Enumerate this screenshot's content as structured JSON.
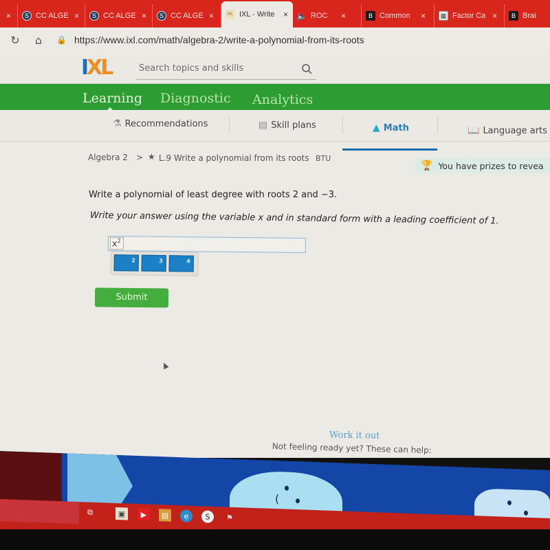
{
  "browser": {
    "tabs": [
      {
        "title": "",
        "icon": "close-only",
        "active": false
      },
      {
        "title": "CC ALGEB",
        "icon": "schoology-icon",
        "active": false
      },
      {
        "title": "CC ALGEB",
        "icon": "schoology-icon",
        "active": false
      },
      {
        "title": "CC ALGEB",
        "icon": "schoology-icon",
        "active": false
      },
      {
        "title": "IXL - Write",
        "icon": "ixl-icon",
        "active": true
      },
      {
        "title": "ROC",
        "icon": "speaker-icon",
        "active": false
      },
      {
        "title": "Common",
        "icon": "brainly-icon",
        "active": false
      },
      {
        "title": "Factor Ca",
        "icon": "calculator-icon",
        "active": false
      },
      {
        "title": "Brai",
        "icon": "brainly-icon",
        "active": false
      }
    ],
    "close_glyph": "×",
    "url": "https://www.ixl.com/math/algebra-2/write-a-polynomial-from-its-roots"
  },
  "header": {
    "logo_i": "I",
    "logo_xl": "XL",
    "search_placeholder": "Search topics and skills"
  },
  "main_nav": {
    "items": [
      "Learning",
      "Diagnostic",
      "Analytics"
    ],
    "active": "Learning"
  },
  "sub_nav": {
    "items": [
      {
        "label": "Recommendations",
        "icon": "recommendations-icon"
      },
      {
        "label": "Skill plans",
        "icon": "skill-plans-icon"
      },
      {
        "label": "Math",
        "icon": "math-pyramid-icon",
        "active": true
      },
      {
        "label": "Language arts",
        "icon": "book-icon"
      }
    ]
  },
  "breadcrumb": {
    "parent": "Algebra 2",
    "separator": ">",
    "skill": "L.9 Write a polynomial from its roots",
    "code": "BTU"
  },
  "prizes_banner": "You have prizes to revea",
  "question": {
    "prompt": "Write a polynomial of least degree with roots 2 and −3.",
    "instruction": "Write your answer using the variable x and in standard form with a leading coefficient of 1.",
    "answer_value": "x",
    "answer_exponent": "2",
    "exponent_keys": [
      "2",
      "3",
      "4"
    ],
    "submit_label": "Submit"
  },
  "help": {
    "title": "Work it out",
    "subtitle": "Not feeling ready yet? These can help:"
  },
  "taskbar": {
    "icons": [
      "task-view-icon",
      "store-icon",
      "youtube-icon",
      "app-icon",
      "edge-icon",
      "schoology-icon",
      "app-icon-2"
    ]
  },
  "colors": {
    "browser_red": "#d8261c",
    "ixl_green": "#2d9d33",
    "submit_green": "#45ad3e",
    "key_blue": "#1c80c7",
    "logo_blue": "#1c6bc4",
    "logo_orange": "#f08c24"
  }
}
